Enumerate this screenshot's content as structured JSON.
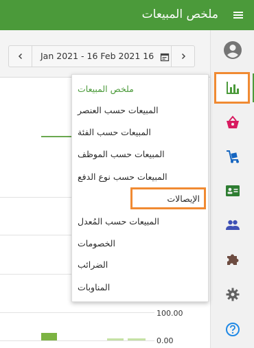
{
  "header": {
    "title": "ملخص المبيعات",
    "menu_icon": "hamburger-menu-icon",
    "bg_color": "#4b9a3a"
  },
  "date_range": {
    "text": "Jan 2021 - 16 Feb 2021 16",
    "prev_icon": "chevron-left-icon",
    "next_icon": "chevron-right-icon",
    "calendar_icon": "calendar-icon"
  },
  "sidebar": {
    "items": [
      {
        "icon": "account-circle-icon",
        "color": "#757575"
      },
      {
        "icon": "bar-chart-icon",
        "color": "#4b9a3a",
        "active": true
      },
      {
        "icon": "shopping-basket-icon",
        "color": "#d81b60"
      },
      {
        "icon": "dolly-icon",
        "color": "#1565c0"
      },
      {
        "icon": "contact-card-icon",
        "color": "#2e7d32"
      },
      {
        "icon": "people-icon",
        "color": "#3f51b5"
      },
      {
        "icon": "puzzle-icon",
        "color": "#6d4c41"
      },
      {
        "icon": "gear-icon",
        "color": "#616161"
      },
      {
        "icon": "help-icon",
        "color": "#1e88e5"
      }
    ]
  },
  "menu": {
    "items": [
      {
        "label": "ملخص المبيعات",
        "selected": true
      },
      {
        "label": "المبيعات حسب العنصر"
      },
      {
        "label": "المبيعات حسب الفئة"
      },
      {
        "label": "المبيعات حسب الموظف"
      },
      {
        "label": "المبيعات حسب نوع الدفع"
      },
      {
        "label": "الإيصالات",
        "highlighted": true
      },
      {
        "label": "المبيعات حسب المُعدل"
      },
      {
        "label": "الخصومات"
      },
      {
        "label": "الضرائب"
      },
      {
        "label": "المناوبات"
      }
    ]
  },
  "chart": {
    "y_ticks": [
      "100.00",
      "0.00"
    ],
    "accent_color": "#7cb342"
  }
}
